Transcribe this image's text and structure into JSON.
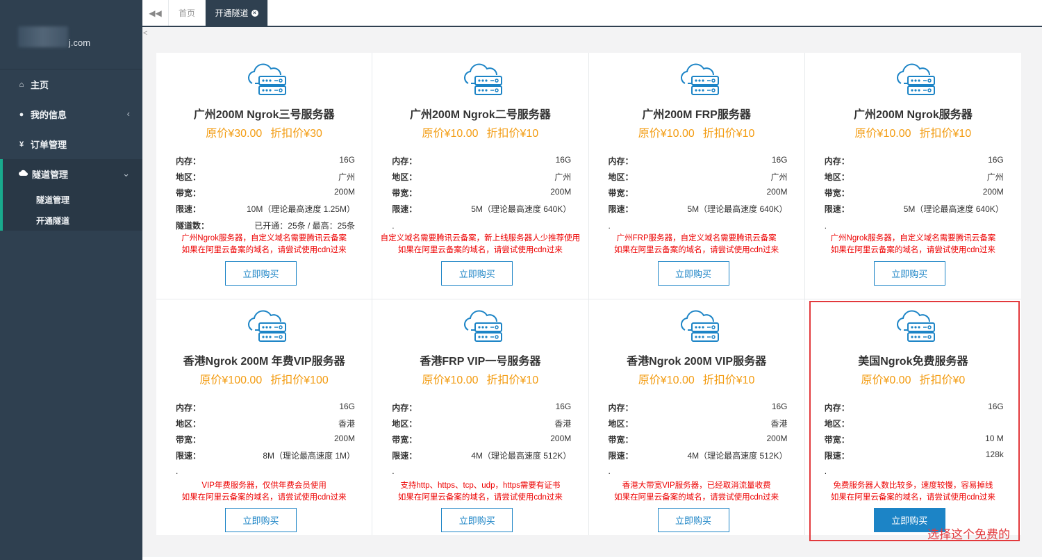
{
  "sidebar": {
    "logo_suffix": "j.com",
    "nav": [
      {
        "icon": "home-icon",
        "glyph": "⌂",
        "label": "主页"
      },
      {
        "icon": "user-icon",
        "glyph": "●",
        "label": "我的信息",
        "chevron": "‹"
      },
      {
        "icon": "yen-icon",
        "glyph": "¥",
        "label": "订单管理"
      }
    ],
    "group": {
      "icon": "cloud-icon",
      "label": "隧道管理",
      "chevron": "⌄",
      "sub": [
        "隧道管理",
        "开通隧道"
      ]
    }
  },
  "tabs": {
    "back": "◀◀",
    "home": "首页",
    "active": "开通隧道",
    "close": "×"
  },
  "caret": "<",
  "labels": {
    "mem": "内存：",
    "region": "地区：",
    "bw": "带宽：",
    "limit": "限速：",
    "tunnels": "隧道数：",
    "buy": "立即购买"
  },
  "cards": [
    {
      "title": "广州200M Ngrok三号服务器",
      "orig": "原价¥30.00",
      "disc": "折扣价¥30",
      "mem": "16G",
      "region": "广州",
      "bw": "200M",
      "limit": "10M（理论最高速度 1.25M）",
      "tunnels": "已开通：25条 / 最高：25条",
      "note1": "广州Ngrok服务器，自定义域名需要腾讯云备案",
      "note2": "如果在阿里云备案的域名，请尝试使用cdn过来"
    },
    {
      "title": "广州200M Ngrok二号服务器",
      "orig": "原价¥10.00",
      "disc": "折扣价¥10",
      "mem": "16G",
      "region": "广州",
      "bw": "200M",
      "limit": "5M（理论最高速度 640K）",
      "dot": ".",
      "note1": "自定义域名需要腾讯云备案，新上线服务器人少推荐使用",
      "note2": "如果在阿里云备案的域名，请尝试使用cdn过来"
    },
    {
      "title": "广州200M FRP服务器",
      "orig": "原价¥10.00",
      "disc": "折扣价¥10",
      "mem": "16G",
      "region": "广州",
      "bw": "200M",
      "limit": "5M（理论最高速度 640K）",
      "dot": ".",
      "note1": "广州FRP服务器，自定义域名需要腾讯云备案",
      "note2": "如果在阿里云备案的域名，请尝试使用cdn过来"
    },
    {
      "title": "广州200M Ngrok服务器",
      "orig": "原价¥10.00",
      "disc": "折扣价¥10",
      "mem": "16G",
      "region": "广州",
      "bw": "200M",
      "limit": "5M（理论最高速度 640K）",
      "dot": ".",
      "note1": "广州Ngrok服务器，自定义域名需要腾讯云备案",
      "note2": "如果在阿里云备案的域名，请尝试使用cdn过来"
    },
    {
      "title": "香港Ngrok 200M 年费VIP服务器",
      "orig": "原价¥100.00",
      "disc": "折扣价¥100",
      "mem": "16G",
      "region": "香港",
      "bw": "200M",
      "limit": "8M（理论最高速度 1M）",
      "dot": ".",
      "note1": "VIP年费服务器，仅供年费会员使用",
      "note2": "如果在阿里云备案的域名，请尝试使用cdn过来"
    },
    {
      "title": "香港FRP VIP一号服务器",
      "orig": "原价¥10.00",
      "disc": "折扣价¥10",
      "mem": "16G",
      "region": "香港",
      "bw": "200M",
      "limit": "4M（理论最高速度 512K）",
      "dot": ".",
      "note1": "支持http、https、tcp、udp，https需要有证书",
      "note2": "如果在阿里云备案的域名，请尝试使用cdn过来"
    },
    {
      "title": "香港Ngrok 200M VIP服务器",
      "orig": "原价¥10.00",
      "disc": "折扣价¥10",
      "mem": "16G",
      "region": "香港",
      "bw": "200M",
      "limit": "4M（理论最高速度 512K）",
      "dot": ".",
      "note1": "香港大带宽VIP服务器，已经取消流量收费",
      "note2": "如果在阿里云备案的域名，请尝试使用cdn过来"
    },
    {
      "title": "美国Ngrok免费服务器",
      "orig": "原价¥0.00",
      "disc": "折扣价¥0",
      "mem": "16G",
      "region": "",
      "bw": "10 M",
      "limit": "128k",
      "dot": ".",
      "note1": "免费服务器人数比较多，速度较慢，容易掉线",
      "note2": "如果在阿里云备案的域名，请尝试使用cdn过来",
      "primary": true
    }
  ],
  "annotation": "选择这个免费的",
  "colors": {
    "sidebar": "#2f4050",
    "accent": "#19aa8d",
    "price": "#f39c12",
    "note": "#ed0000",
    "button": "#1c84c6",
    "highlight": "#e2393c"
  }
}
